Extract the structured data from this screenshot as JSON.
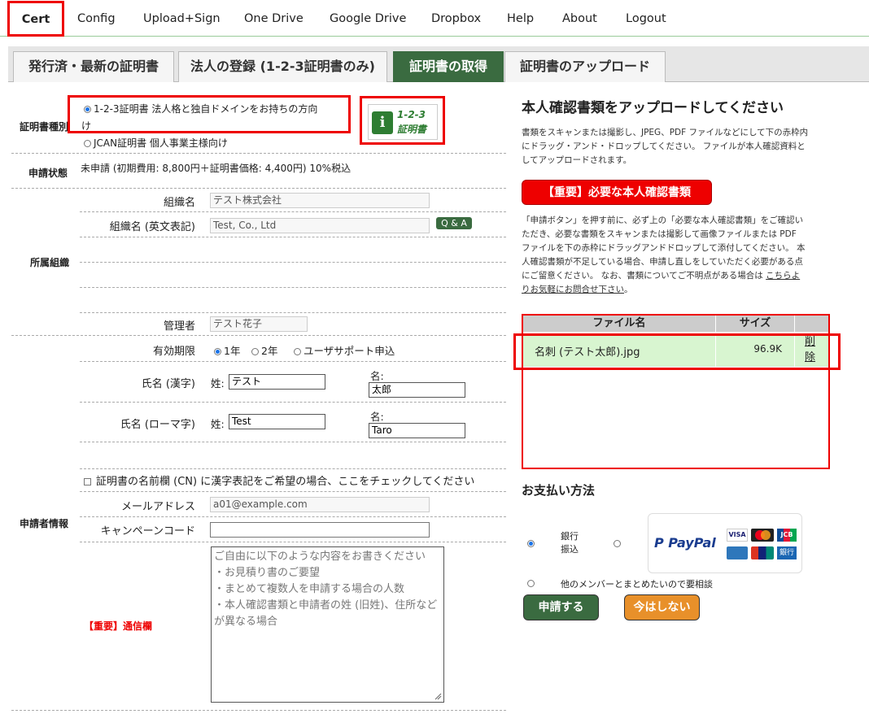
{
  "nav": {
    "items": [
      "Cert",
      "Config",
      "Upload+Sign",
      "One Drive",
      "Google Drive",
      "Dropbox",
      "Help",
      "About",
      "Logout"
    ]
  },
  "tabs": [
    "発行済・最新の証明書",
    "法人の登録 (1-2-3証明書のみ)",
    "証明書の取得",
    "証明書のアップロード"
  ],
  "form": {
    "cert_type_label": "証明書種別",
    "cert_type_option1_line1": "1-2-3証明書 法人格と独自ドメインをお持ちの方向",
    "cert_type_option1_line2": "け",
    "cert_type_option2": "JCAN証明書 個人事業主様向け",
    "logo_text_top": "1-2-3",
    "logo_text_bottom": "証明書",
    "status_label": "申請状態",
    "status_value": "未申請 (初期費用: 8,800円＋証明書価格: 4,400円) 10%税込",
    "org_section_label": "所属組織",
    "org_name_label": "組織名",
    "org_name_value": "テスト株式会社",
    "org_name_en_label": "組織名 (英文表記)",
    "org_name_en_value": "Test, Co., Ltd",
    "qa_badge": "Q & A",
    "admin_label": "管理者",
    "admin_value": "テスト花子",
    "validity_label": "有効期限",
    "validity_options": [
      "1年",
      "2年",
      "ユーザサポート申込"
    ],
    "name_kanji_label": "氏名 (漢字)",
    "surname_label": "姓:",
    "given_label": "名:",
    "surname_kanji": "テスト",
    "given_kanji": "太郎",
    "name_roman_label": "氏名 (ローマ字)",
    "surname_roman": "Test",
    "given_roman": "Taro",
    "applicant_section_label": "申請者情報",
    "cn_checkbox": "証明書の名前欄 (CN) に漢字表記をご希望の場合、ここをチェックしてください",
    "email_label": "メールアドレス",
    "email_value": "a01@example.com",
    "campaign_label": "キャンペーンコード",
    "campaign_value": "",
    "message_label": "【重要】通信欄",
    "message_placeholder_lines": [
      "ご自由に以下のような内容をお書きください",
      "・お見積り書のご要望",
      "・まとめて複数人を申請する場合の人数",
      "・本人確認書類と申請者の姓 (旧姓)、住所など",
      "が異なる場合"
    ]
  },
  "right": {
    "title": "本人確認書類をアップロードしてください",
    "desc_lines": [
      "書類をスキャンまたは撮影し、JPEG、PDF ファイルなどにして下の赤枠内",
      "にドラッグ・アンド・ドロップしてください。 ファイルが本人確認資料と",
      "してアップロードされます。"
    ],
    "important_button": "【重要】必要な本人確認書類",
    "note_lines": [
      "「申請ボタン」を押す前に、必ず上の「必要な本人確認書類」をご確認い",
      "ただき、必要な書類をスキャンまたは撮影して画像ファイルまたは PDF",
      "ファイルを下の赤枠にドラッグアンドドロップして添付してください。 本",
      "人確認書類が不足している場合、申請し直しをしていただく必要がある点",
      "にご留意ください。 なお、書類についてご不明点がある場合は"
    ],
    "contact_link_part1": "こちらよ",
    "contact_link_part2": "りお気軽にお問合せ下さい",
    "note_end": "。",
    "file_table": {
      "headers": [
        "ファイル名",
        "サイズ"
      ],
      "rows": [
        {
          "name": "名刺 (テスト太郎).jpg",
          "size": "96.9K",
          "action_line1": "削",
          "action_line2": "除"
        }
      ]
    },
    "payment_title": "お支払い方法",
    "bank_line1": "銀行",
    "bank_line2": "振込",
    "paypal_text": "PayPal",
    "other_option": "他のメンバーとまとめたいので要相談",
    "submit_button": "申請する",
    "later_button": "今はしない",
    "card_labels": [
      "VISA",
      "JCB",
      "銀行"
    ]
  },
  "colors": {
    "active_tab": "#3a6b40",
    "highlight": "#e00000",
    "file_row": "#d8f5d0",
    "later_button": "#e8902a"
  }
}
